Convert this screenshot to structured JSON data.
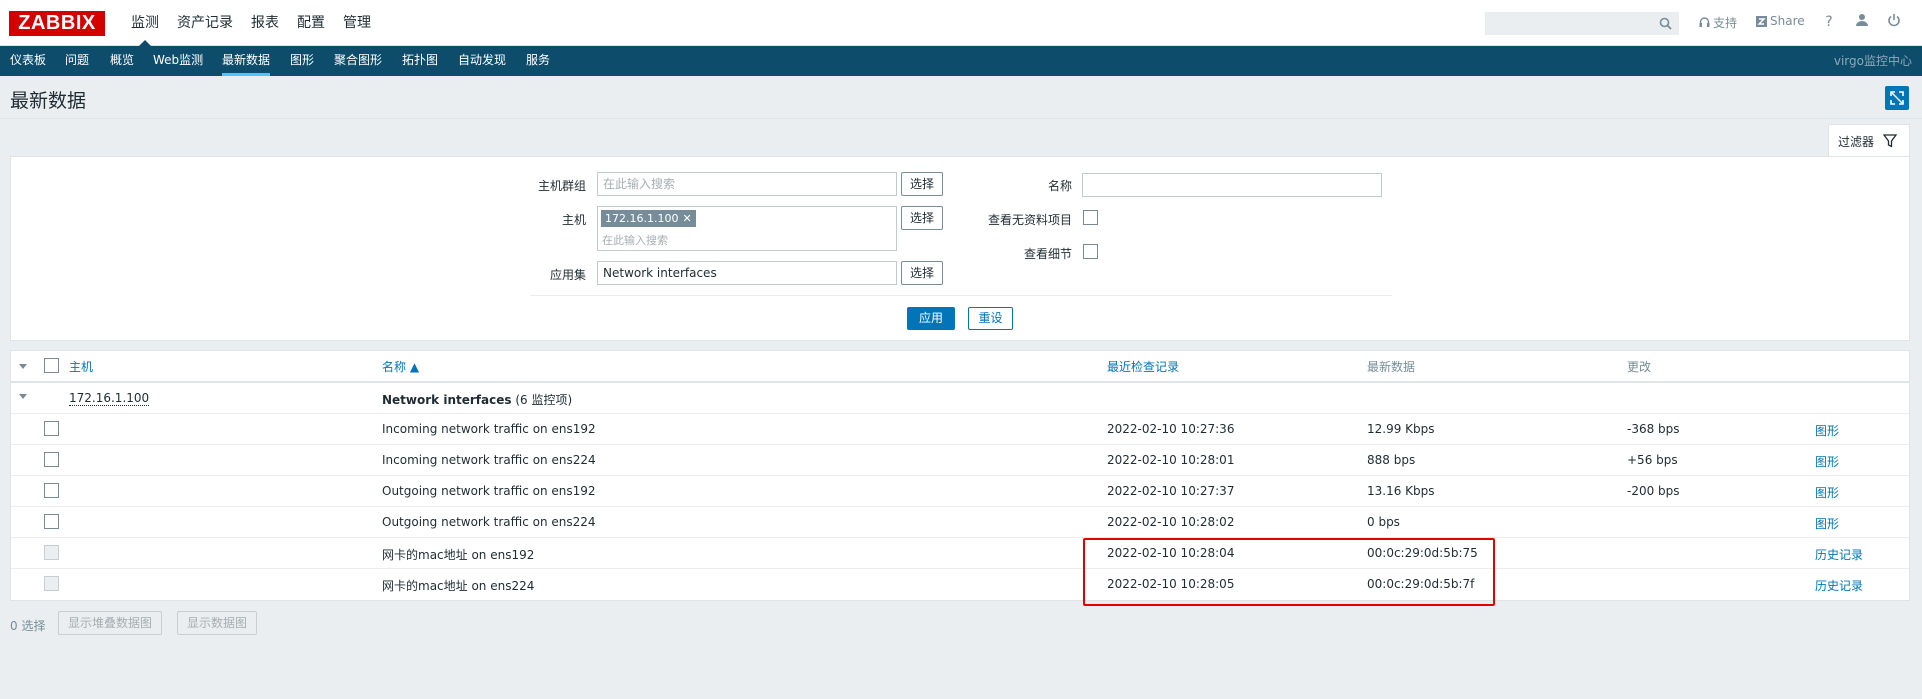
{
  "brand": {
    "logo": "ZABBIX"
  },
  "main_menu": [
    {
      "label": "监测",
      "active": true
    },
    {
      "label": "资产记录"
    },
    {
      "label": "报表"
    },
    {
      "label": "配置"
    },
    {
      "label": "管理"
    }
  ],
  "topbar": {
    "search_placeholder": "",
    "support_label": "支持",
    "share_label": "Share",
    "help_label": "?"
  },
  "sub_menu": [
    {
      "label": "仪表板"
    },
    {
      "label": "问题"
    },
    {
      "label": "概览"
    },
    {
      "label": "Web监测"
    },
    {
      "label": "最新数据",
      "active": true
    },
    {
      "label": "图形"
    },
    {
      "label": "聚合图形"
    },
    {
      "label": "拓扑图"
    },
    {
      "label": "自动发现"
    },
    {
      "label": "服务"
    }
  ],
  "server_name": "virgo监控中心",
  "page": {
    "title": "最新数据"
  },
  "filter": {
    "tab_label": "过滤器",
    "host_group_label": "主机群组",
    "host_group_placeholder": "在此输入搜索",
    "host_label": "主机",
    "host_tag": "172.16.1.100",
    "host_placeholder": "在此输入搜索",
    "application_label": "应用集",
    "application_value": "Network interfaces",
    "select_label": "选择",
    "name_label": "名称",
    "name_value": "",
    "show_without_data_label": "查看无资料项目",
    "show_details_label": "查看细节",
    "apply_label": "应用",
    "reset_label": "重设"
  },
  "table": {
    "columns": {
      "host": "主机",
      "name": "名称 ▲",
      "last_check": "最近检查记录",
      "last_value": "最新数据",
      "change": "更改"
    },
    "group": {
      "host": "172.16.1.100",
      "name": "Network interfaces",
      "count": "(6 监控项)"
    },
    "rows": [
      {
        "name": "Incoming network traffic on ens192",
        "last_check": "2022-02-10 10:27:36",
        "last_value": "12.99 Kbps",
        "change": "-368 bps",
        "action": "图形"
      },
      {
        "name": "Incoming network traffic on ens224",
        "last_check": "2022-02-10 10:28:01",
        "last_value": "888 bps",
        "change": "+56 bps",
        "action": "图形"
      },
      {
        "name": "Outgoing network traffic on ens192",
        "last_check": "2022-02-10 10:27:37",
        "last_value": "13.16 Kbps",
        "change": "-200 bps",
        "action": "图形"
      },
      {
        "name": "Outgoing network traffic on ens224",
        "last_check": "2022-02-10 10:28:02",
        "last_value": "0 bps",
        "change": "",
        "action": "图形"
      },
      {
        "name": "网卡的mac地址 on ens192",
        "last_check": "2022-02-10 10:28:04",
        "last_value": "00:0c:29:0d:5b:75",
        "change": "",
        "action": "历史记录"
      },
      {
        "name": "网卡的mac地址 on ens224",
        "last_check": "2022-02-10 10:28:05",
        "last_value": "00:0c:29:0d:5b:7f",
        "change": "",
        "action": "历史记录"
      }
    ]
  },
  "footer": {
    "selected": "0 选择",
    "stacked_graph_label": "显示堆叠数据图",
    "data_graph_label": "显示数据图"
  }
}
